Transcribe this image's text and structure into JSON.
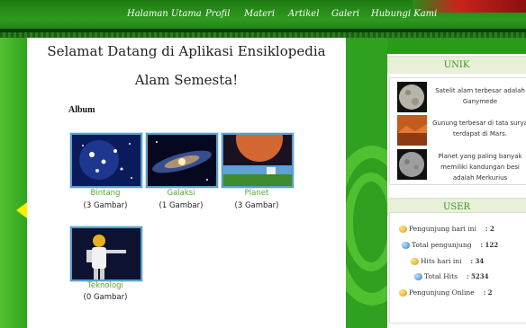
{
  "nav": {
    "items": [
      "Halaman Utama",
      "Profil",
      "Materi",
      "Artikel",
      "Galeri",
      "Hubungi Kami"
    ],
    "active_index": 3
  },
  "welcome": {
    "line1": "Selamat Datang di Aplikasi Ensiklopedia",
    "line2": "Alam Semesta!"
  },
  "album": {
    "title": "Album",
    "items": [
      {
        "name": "Bintang",
        "count": "(3 Gambar)",
        "icon": "star-cluster-thumbnail"
      },
      {
        "name": "Galaksi",
        "count": "(1 Gambar)",
        "icon": "galaxy-thumbnail"
      },
      {
        "name": "Planet",
        "count": "(3 Gambar)",
        "icon": "planet-landscape-thumbnail"
      },
      {
        "name": "Teknologi",
        "count": "(0 Gambar)",
        "icon": "robot-thumbnail"
      }
    ]
  },
  "unik": {
    "title": "UNIK",
    "items": [
      {
        "text": "Satelit alam terbesar adalah Ganymede",
        "icon": "moon-thumbnail"
      },
      {
        "text": "Gunung terbesar di tata surya terdapat di Mars.",
        "icon": "mars-surface-thumbnail"
      },
      {
        "text": "Planet yang paling banyak memiliki kandungan besi adalah Merkurius",
        "icon": "mercury-thumbnail"
      }
    ]
  },
  "user": {
    "title": "USER",
    "rows": [
      {
        "label": "Pengunjung hari ini",
        "value": ": 2",
        "icon": "user-yellow-icon"
      },
      {
        "label": "Total pengunjung",
        "value": ": 122",
        "icon": "user-blue-icon"
      },
      {
        "label": "Hits hari ini",
        "value": ": 34",
        "icon": "user-yellow-icon"
      },
      {
        "label": "Total Hits",
        "value": ": 5234",
        "icon": "user-blue-icon"
      },
      {
        "label": "Pengunjung Online",
        "value": ": 2",
        "icon": "user-yellow-icon"
      }
    ]
  },
  "colors": {
    "accent_green": "#3e9120",
    "link_green": "#5aa52a",
    "nav_bg": "#2e9b1e"
  }
}
